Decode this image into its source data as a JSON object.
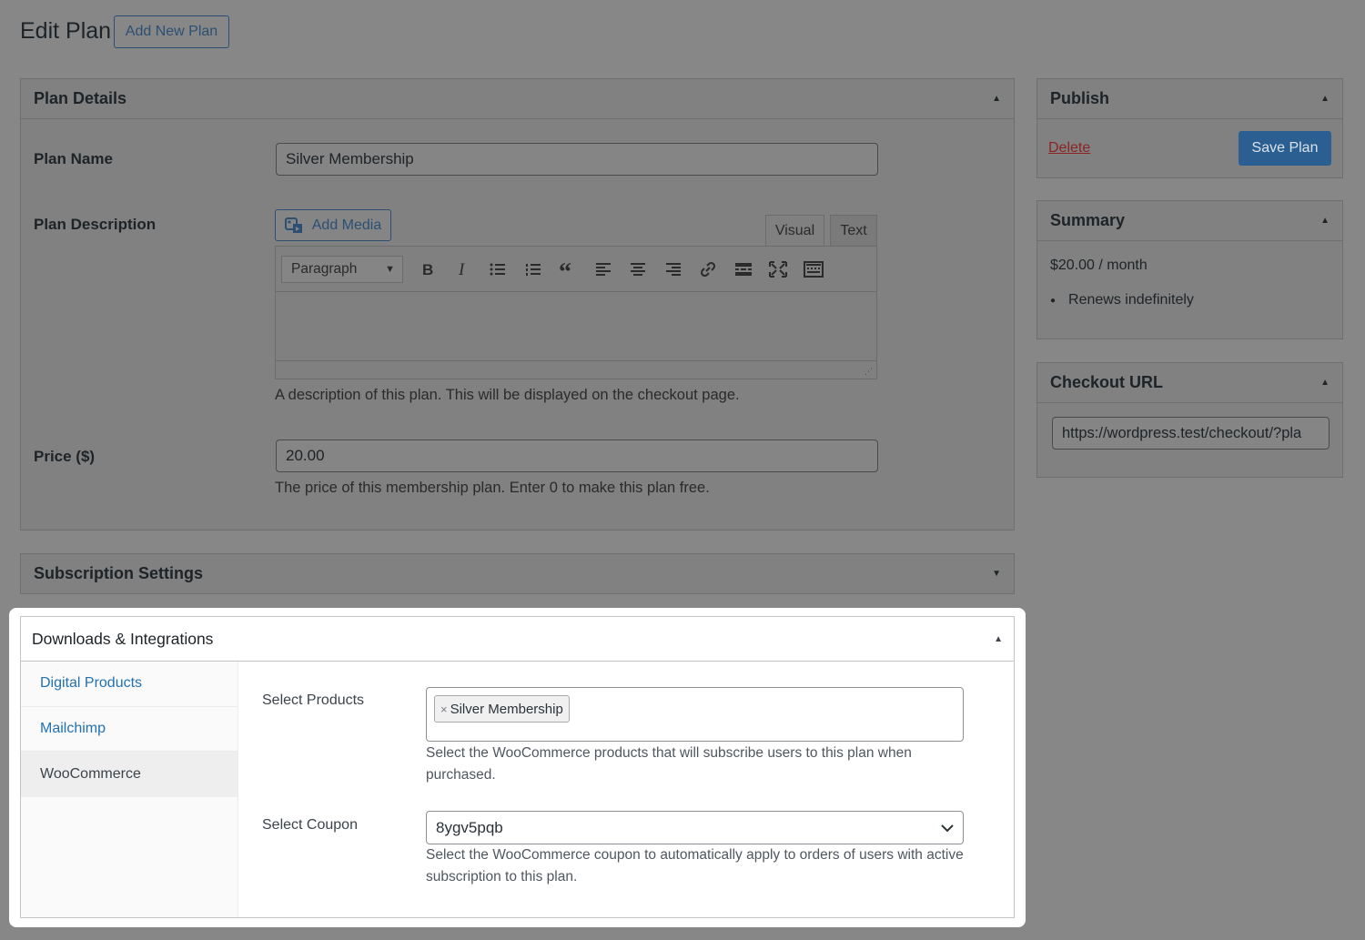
{
  "header": {
    "title": "Edit Plan",
    "add_new_label": "Add New Plan"
  },
  "plan_details": {
    "title": "Plan Details",
    "plan_name_label": "Plan Name",
    "plan_name_value": "Silver Membership",
    "plan_description_label": "Plan Description",
    "add_media_label": "Add Media",
    "tab_visual": "Visual",
    "tab_text": "Text",
    "format_select": "Paragraph",
    "description_help": "A description of this plan. This will be displayed on the checkout page.",
    "price_label": "Price ($)",
    "price_value": "20.00",
    "price_help": "The price of this membership plan. Enter 0 to make this plan free."
  },
  "subscription_settings": {
    "title": "Subscription Settings"
  },
  "downloads": {
    "title": "Downloads & Integrations",
    "nav": [
      "Digital Products",
      "Mailchimp",
      "WooCommerce"
    ],
    "active_nav": "WooCommerce",
    "select_products_label": "Select Products",
    "selected_product": "Silver Membership",
    "products_help": "Select the WooCommerce products that will subscribe users to this plan when purchased.",
    "select_coupon_label": "Select Coupon",
    "coupon_value": "8ygv5pqb",
    "coupon_help": "Select the WooCommerce coupon to automatically apply to orders of users with active subscription to this plan."
  },
  "publish": {
    "title": "Publish",
    "delete_label": "Delete",
    "save_label": "Save Plan"
  },
  "summary": {
    "title": "Summary",
    "price_line": "$20.00 / month",
    "renewal": "Renews indefinitely"
  },
  "checkout": {
    "title": "Checkout URL",
    "url": "https://wordpress.test/checkout/?pla"
  },
  "colors": {
    "overlay_bg": "#878787",
    "link": "#2271b1",
    "primary_button": "#2c5f91",
    "delete": "#8a2424"
  }
}
